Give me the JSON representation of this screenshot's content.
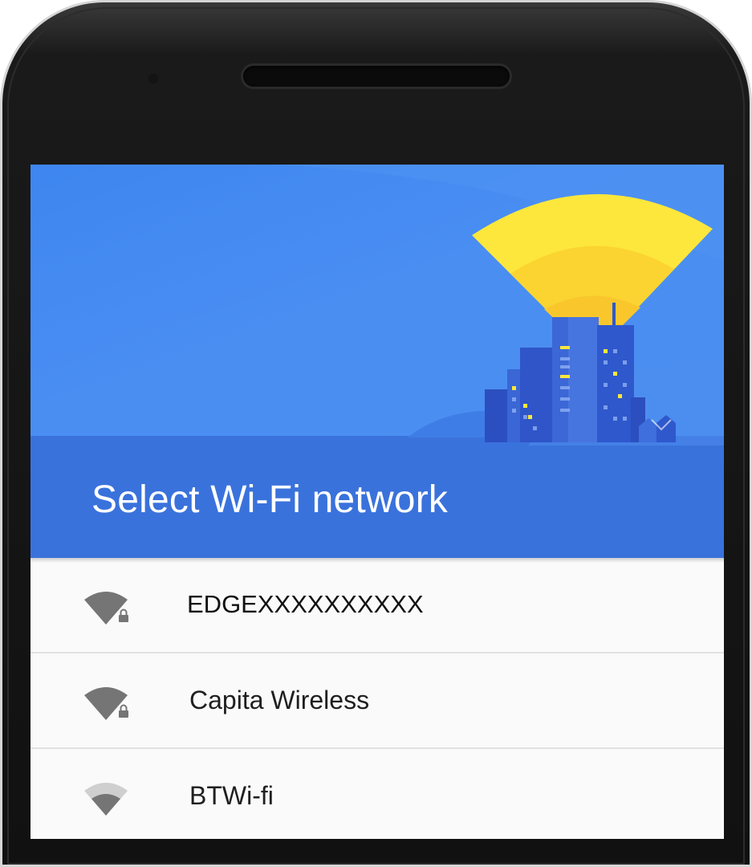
{
  "screen": {
    "title": "Select Wi-Fi network"
  },
  "networks": [
    {
      "name": "EDGEXXXXXXXXXX",
      "icon": "wifi-locked-icon",
      "secured": true,
      "signal": "strong"
    },
    {
      "name": "Capita Wireless",
      "icon": "wifi-locked-icon",
      "secured": true,
      "signal": "strong"
    },
    {
      "name": "BTWi-fi",
      "icon": "wifi-icon",
      "secured": false,
      "signal": "medium"
    }
  ],
  "colors": {
    "hero_blue": "#4a8ef2",
    "hero_band": "#3a72dc",
    "signal_yellow": "#fde73c",
    "wifi_icon": "#757575"
  }
}
